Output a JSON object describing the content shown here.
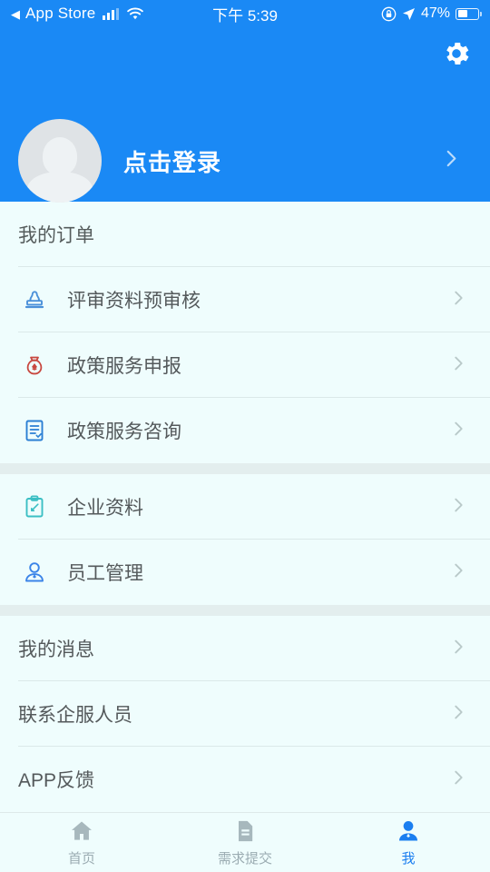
{
  "theme": {
    "primary": "#1a89f5",
    "page_bg": "#effdfd",
    "divider_bg": "#e3eeee",
    "text": "#54595b",
    "muted": "#9bacb2",
    "active": "#1a7ef0"
  },
  "status_bar": {
    "back_icon": "back-triangle-icon",
    "carrier_label": "App Store",
    "signal_icon": "cellular-signal-icon",
    "wifi_icon": "wifi-icon",
    "time": "下午 5:39",
    "rotation_lock_icon": "rotation-lock-icon",
    "location_icon": "location-arrow-icon",
    "battery_percent": "47%",
    "battery_icon": "battery-icon"
  },
  "header": {
    "settings_icon": "gear-icon",
    "avatar_icon": "default-avatar-icon",
    "login_label": "点击登录",
    "chevron_icon": "chevron-right-icon"
  },
  "groups": [
    {
      "title": "我的订单",
      "items": [
        {
          "label": "评审资料预审核",
          "icon": "stamp-icon",
          "icon_color": "#4a90d9"
        },
        {
          "label": "政策服务申报",
          "icon": "money-bag-icon",
          "icon_color": "#c8473f"
        },
        {
          "label": "政策服务咨询",
          "icon": "document-check-icon",
          "icon_color": "#2b7fd4"
        }
      ]
    },
    {
      "title": null,
      "items": [
        {
          "label": "企业资料",
          "icon": "clipboard-edit-icon",
          "icon_color": "#3bbfc4"
        },
        {
          "label": "员工管理",
          "icon": "user-icon",
          "icon_color": "#3b84e8"
        }
      ]
    },
    {
      "title": null,
      "items": [
        {
          "label": "我的消息",
          "icon": null,
          "icon_color": null
        },
        {
          "label": "联系企服人员",
          "icon": null,
          "icon_color": null
        },
        {
          "label": "APP反馈",
          "icon": null,
          "icon_color": null
        }
      ]
    }
  ],
  "tabbar": {
    "tabs": [
      {
        "label": "首页",
        "icon": "home-icon",
        "active": false
      },
      {
        "label": "需求提交",
        "icon": "document-icon",
        "active": false
      },
      {
        "label": "我",
        "icon": "person-icon",
        "active": true
      }
    ]
  }
}
